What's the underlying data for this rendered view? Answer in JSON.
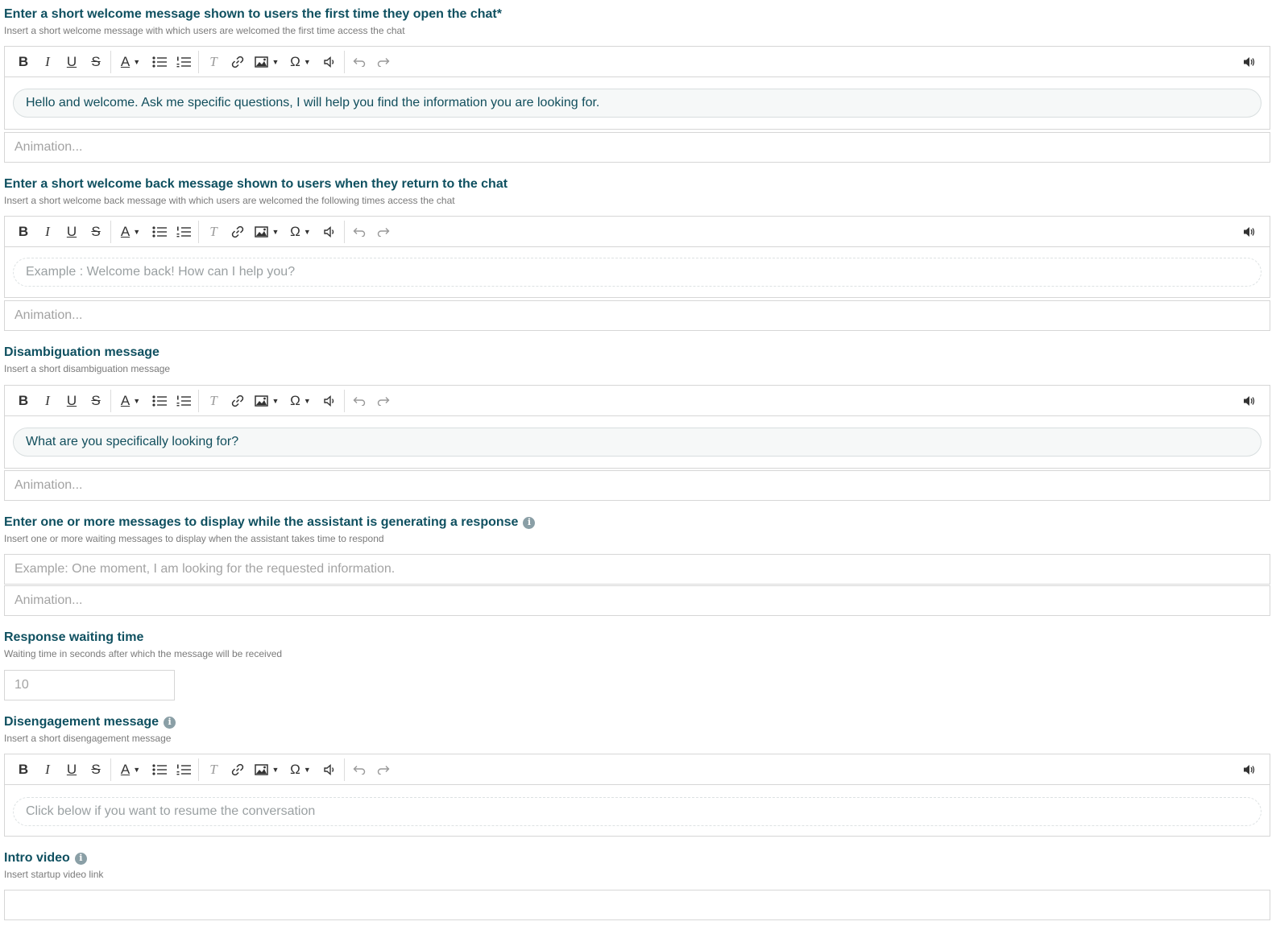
{
  "welcome": {
    "title": "Enter a short welcome message shown to users the first time they open the chat*",
    "subtitle": "Insert a short welcome message with which users are welcomed the first time access the chat",
    "value": "Hello and welcome. Ask me specific questions, I will help you find the information you are looking for.",
    "animation_placeholder": "Animation..."
  },
  "welcome_back": {
    "title": "Enter a short welcome back message shown to users when they return to the chat",
    "subtitle": "Insert a short welcome back message with which users are welcomed the following times access the chat",
    "placeholder": "Example : Welcome back! How can I help you?",
    "animation_placeholder": "Animation..."
  },
  "disambiguation": {
    "title": "Disambiguation message",
    "subtitle": "Insert a short disambiguation message",
    "value": "What are you specifically looking for?",
    "animation_placeholder": "Animation..."
  },
  "waiting": {
    "title": "Enter one or more messages to display while the assistant is generating a response",
    "subtitle": "Insert one or more waiting messages to display when the assistant takes time to respond",
    "placeholder": "Example: One moment, I am looking for the requested information.",
    "animation_placeholder": "Animation..."
  },
  "response_time": {
    "title": "Response waiting time",
    "subtitle": "Waiting time in seconds after which the message will be received",
    "placeholder": "10"
  },
  "disengagement": {
    "title": "Disengagement message",
    "subtitle": "Insert a short disengagement message",
    "placeholder": "Click below if you want to resume the conversation"
  },
  "intro_video": {
    "title": "Intro video",
    "subtitle": "Insert startup video link",
    "value": ""
  },
  "toolbar": {
    "bold": "B",
    "italic": "I",
    "underline": "U",
    "strike": "S",
    "font_color": "A",
    "clear_format": "T",
    "special_char": "Ω",
    "info": "i"
  },
  "icons": [
    "bold-icon",
    "italic-icon",
    "underline-icon",
    "strikethrough-icon",
    "font-color-icon",
    "bulleted-list-icon",
    "numbered-list-icon",
    "clear-format-icon",
    "link-icon",
    "image-icon",
    "special-char-icon",
    "speaker-icon",
    "undo-icon",
    "redo-icon",
    "info-icon"
  ],
  "colors": {
    "title": "#0f5060",
    "text": "#114e5c",
    "subtitle": "#7a7a7a",
    "border": "#d6d6d6"
  }
}
